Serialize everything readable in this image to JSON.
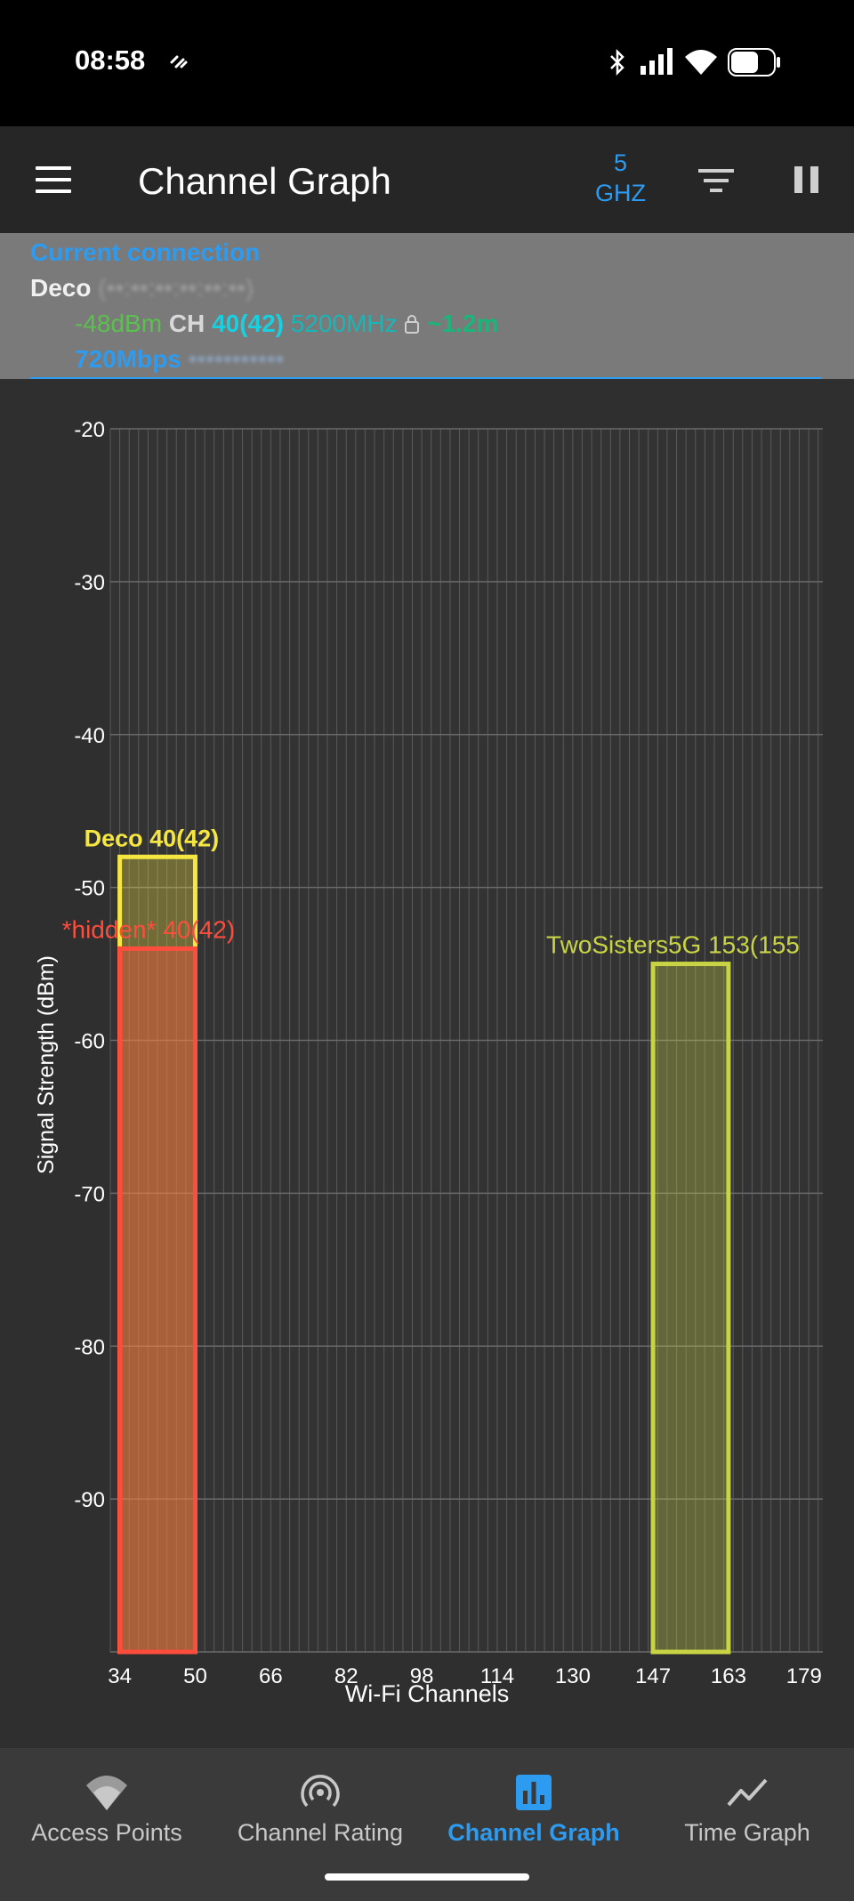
{
  "status": {
    "time": "08:58"
  },
  "app_bar": {
    "title": "Channel Graph",
    "band_line1": "5",
    "band_line2": "GHZ"
  },
  "connection": {
    "header": "Current connection",
    "ssid": "Deco",
    "ssid_detail": "(••:••:••:••:••:••)",
    "signal": "-48dBm",
    "ch_label": "CH",
    "channel": "40(42)",
    "frequency": "5200MHz",
    "distance": "~1.2m",
    "speed": "720Mbps",
    "speed_detail": "•••••••••••"
  },
  "chart_data": {
    "type": "bar",
    "ylabel": "Signal Strength (dBm)",
    "xlabel": "Wi-Fi Channels",
    "ylim": [
      -100,
      -20
    ],
    "yticks": [
      "-20",
      "-30",
      "-40",
      "-50",
      "-60",
      "-70",
      "-80",
      "-90"
    ],
    "xlim": [
      32,
      183
    ],
    "xticks": [
      "34",
      "50",
      "66",
      "82",
      "98",
      "114",
      "130",
      "147",
      "163",
      "179"
    ],
    "grid": true,
    "series": [
      {
        "label": "Deco 40(42)",
        "x_start": 34,
        "x_end": 50,
        "value": -48,
        "color": "#f5e642"
      },
      {
        "label": "*hidden* 40(42)",
        "x_start": 34,
        "x_end": 50,
        "value": -54,
        "color": "#ff4d3d"
      },
      {
        "label": "TwoSisters5G 153(155",
        "x_start": 147,
        "x_end": 163,
        "value": -55,
        "color": "#c8d444"
      }
    ]
  },
  "nav": {
    "items": [
      {
        "label": "Access Points"
      },
      {
        "label": "Channel Rating"
      },
      {
        "label": "Channel Graph"
      },
      {
        "label": "Time Graph"
      }
    ]
  }
}
